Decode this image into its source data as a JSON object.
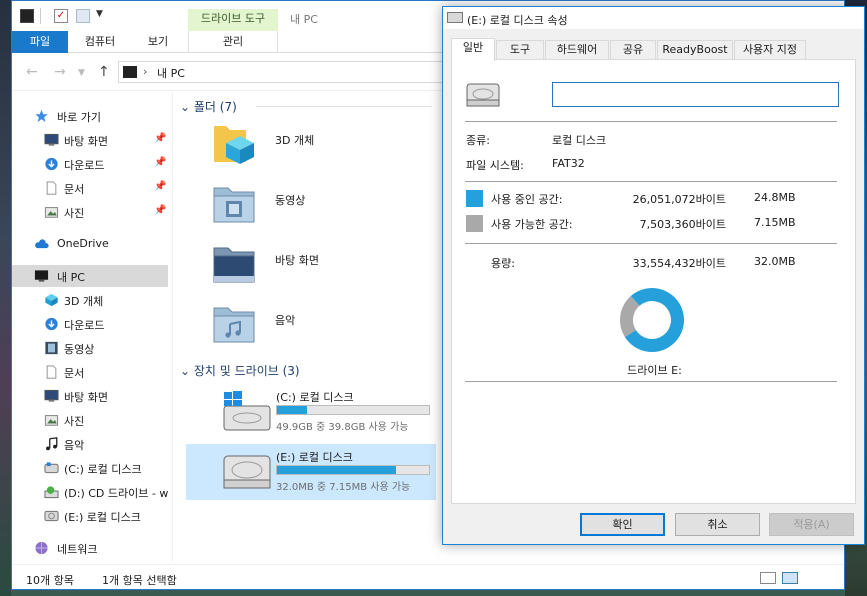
{
  "explorer": {
    "window_title": "내 PC",
    "context_tab": "드라이브 도구",
    "ribbon_tabs": {
      "file": "파일",
      "home": "컴퓨터",
      "view": "보기",
      "manage": "관리"
    },
    "address": {
      "path": "내 PC"
    },
    "nav": {
      "quick_access": "바로 가기",
      "qa_desktop": "바탕 화면",
      "qa_downloads": "다운로드",
      "qa_documents": "문서",
      "qa_pictures": "사진",
      "onedrive": "OneDrive",
      "this_pc": "내 PC",
      "objects3d": "3D 개체",
      "downloads": "다운로드",
      "videos": "동영상",
      "documents": "문서",
      "desktop": "바탕 화면",
      "pictures": "사진",
      "music": "음악",
      "drive_c": "(C:) 로컬 디스크",
      "drive_d": "(D:) CD 드라이브 - w",
      "drive_e": "(E:) 로컬 디스크",
      "network": "네트워크"
    },
    "folders_header": "폴더 (7)",
    "folders": {
      "objects3d": "3D 개체",
      "videos": "동영상",
      "desktop": "바탕 화면",
      "music": "음악"
    },
    "devices_header": "장치 및 드라이브 (3)",
    "drives": {
      "c": {
        "name": "(C:) 로컬 디스크",
        "info": "49.9GB 중 39.8GB 사용 가능",
        "used_fraction": 0.2
      },
      "e": {
        "name": "(E:) 로컬 디스크",
        "info": "32.0MB 중 7.15MB 사용 가능",
        "used_fraction": 0.78
      }
    },
    "status": {
      "count": "10개 항목",
      "selected": "1개 항목 선택함"
    }
  },
  "dialog": {
    "title": "(E:) 로컬 디스크 속성",
    "tabs": [
      "일반",
      "도구",
      "하드웨어",
      "공유",
      "ReadyBoost",
      "사용자 지정"
    ],
    "name_value": "",
    "type_label": "종류:",
    "type_value": "로컬 디스크",
    "fs_label": "파일 시스템:",
    "fs_value": "FAT32",
    "used_label": "사용 중인 공간:",
    "used_bytes": "26,051,072바이트",
    "used_mb": "24.8MB",
    "free_label": "사용 가능한 공간:",
    "free_bytes": "7,503,360바이트",
    "free_mb": "7.15MB",
    "capacity_label": "용량:",
    "capacity_bytes": "33,554,432바이트",
    "capacity_mb": "32.0MB",
    "drive_label": "드라이브 E:",
    "used_fraction": 0.776,
    "colors": {
      "used": "#26a0da",
      "free": "#a9a9a9"
    },
    "buttons": {
      "ok": "확인",
      "cancel": "취소",
      "apply": "적용(A)"
    }
  }
}
